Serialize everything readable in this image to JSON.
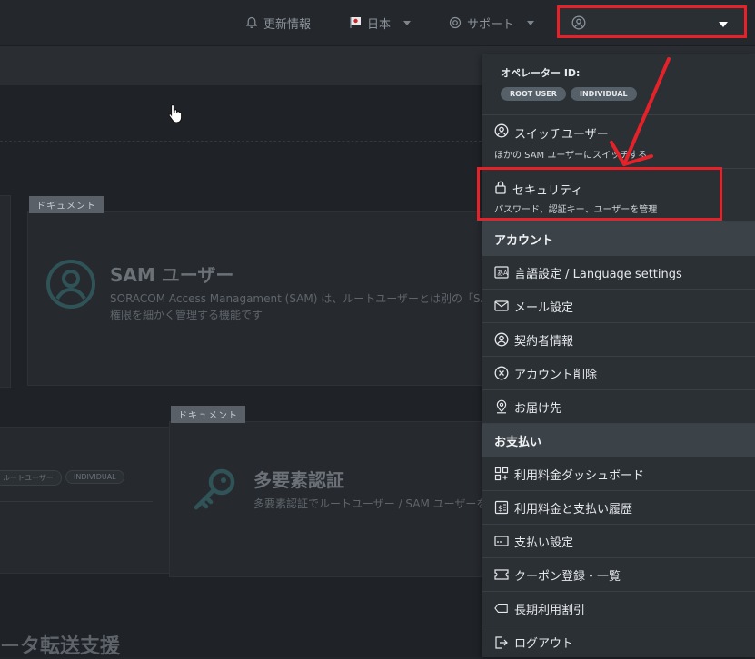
{
  "topbar": {
    "updates_label": "更新情報",
    "region_label": "日本",
    "support_label": "サポート"
  },
  "background": {
    "card1": {
      "tag": "ドキュメント",
      "title": "SAM ユーザー",
      "desc_line1": "SORACOM Access Managament (SAM) は、ルートユーザーとは別の「SAM",
      "desc_line2": "権限を細かく管理する機能です"
    },
    "card2": {
      "tag": "ドキュメント",
      "title": "多要素認証",
      "desc": "多要素認証でルートユーザー / SAM ユーザーを",
      "pill_root": "ルートユーザー",
      "pill_individual": "INDIVIDUAL"
    },
    "section_title": "ータ転送支援"
  },
  "dropdown": {
    "operator_label": "オペレーター ID:",
    "badge_root": "ROOT USER",
    "badge_individual": "INDIVIDUAL",
    "switch_user": {
      "label": "スイッチユーザー",
      "sub": "ほかの SAM ユーザーにスイッチする"
    },
    "security": {
      "label": "セキュリティ",
      "sub": "パスワード、認証キー、ユーザーを管理"
    },
    "account_section": "アカウント",
    "account_items": [
      {
        "label": "言語設定 / Language settings",
        "icon": "language-icon"
      },
      {
        "label": "メール設定",
        "icon": "mail-icon"
      },
      {
        "label": "契約者情報",
        "icon": "user-circle-icon"
      },
      {
        "label": "アカウント削除",
        "icon": "x-circle-icon"
      },
      {
        "label": "お届け先",
        "icon": "location-icon"
      }
    ],
    "billing_section": "お支払い",
    "billing_items": [
      {
        "label": "利用料金ダッシュボード",
        "icon": "dashboard-icon"
      },
      {
        "label": "利用料金と支払い履歴",
        "icon": "receipt-icon"
      },
      {
        "label": "支払い設定",
        "icon": "card-icon"
      },
      {
        "label": "クーポン登録・一覧",
        "icon": "ticket-icon"
      },
      {
        "label": "長期利用割引",
        "icon": "tag-icon"
      }
    ],
    "logout_label": "ログアウト"
  },
  "colors": {
    "highlight": "#e5222a",
    "dropdown_bg": "#2b3035",
    "section_bg": "#3b4248"
  }
}
